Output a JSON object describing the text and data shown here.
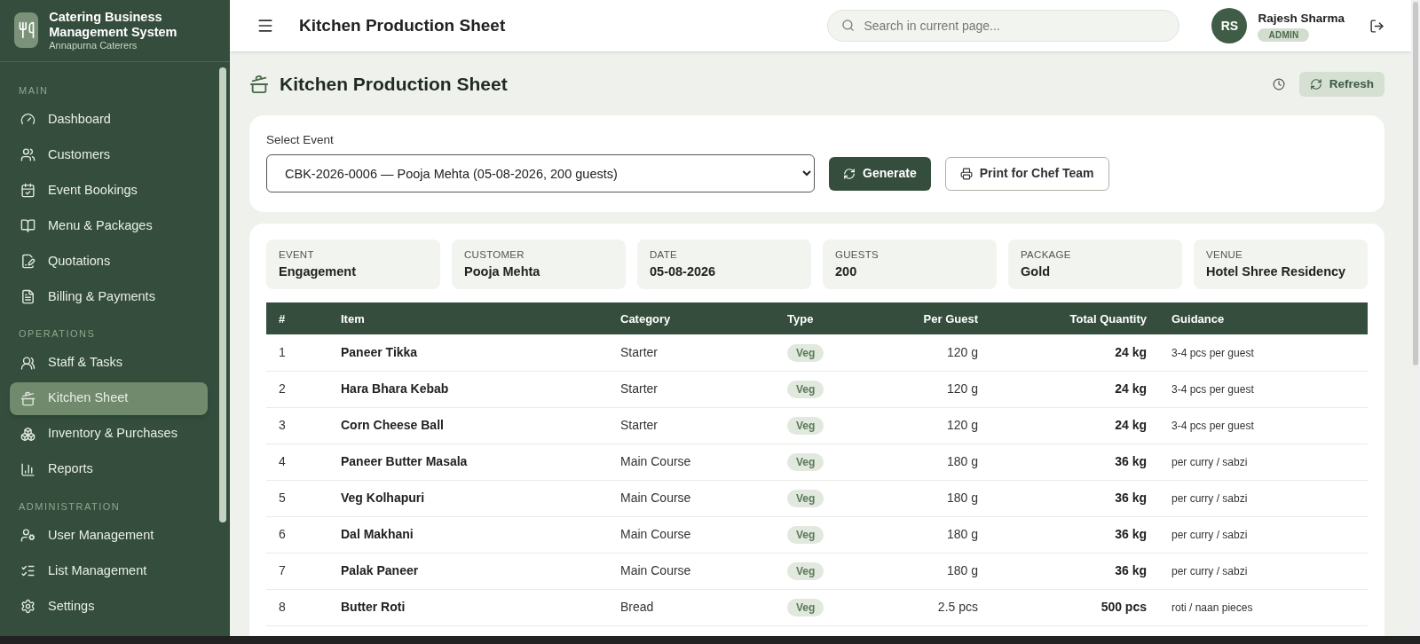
{
  "sidebar": {
    "brand": {
      "title": "Catering Business Management System",
      "subtitle": "Annapurna Caterers"
    },
    "sections": [
      {
        "heading": "MAIN",
        "items": [
          {
            "label": "Dashboard",
            "selected": false
          },
          {
            "label": "Customers",
            "selected": false
          },
          {
            "label": "Event Bookings",
            "selected": false
          },
          {
            "label": "Menu & Packages",
            "selected": false
          },
          {
            "label": "Quotations",
            "selected": false
          },
          {
            "label": "Billing & Payments",
            "selected": false
          }
        ]
      },
      {
        "heading": "OPERATIONS",
        "items": [
          {
            "label": "Staff & Tasks",
            "selected": false
          },
          {
            "label": "Kitchen Sheet",
            "selected": true
          },
          {
            "label": "Inventory & Purchases",
            "selected": false
          },
          {
            "label": "Reports",
            "selected": false
          }
        ]
      },
      {
        "heading": "ADMINISTRATION",
        "items": [
          {
            "label": "User Management",
            "selected": false
          },
          {
            "label": "List Management",
            "selected": false
          },
          {
            "label": "Settings",
            "selected": false
          }
        ]
      }
    ]
  },
  "header": {
    "title": "Kitchen Production Sheet",
    "search": {
      "placeholder": "Search in current page..."
    },
    "user": {
      "initials": "RS",
      "name": "Rajesh Sharma",
      "role": "ADMIN"
    }
  },
  "page": {
    "title": "Kitchen Production Sheet",
    "refresh": "Refresh"
  },
  "event_select": {
    "label": "Select Event",
    "value": "CBK-2026-0006 — Pooja Mehta (05-08-2026, 200 guests)",
    "generate": "Generate",
    "print": "Print for Chef Team"
  },
  "summary": [
    {
      "label": "EVENT",
      "value": "Engagement"
    },
    {
      "label": "CUSTOMER",
      "value": "Pooja Mehta"
    },
    {
      "label": "DATE",
      "value": "05-08-2026"
    },
    {
      "label": "GUESTS",
      "value": "200"
    },
    {
      "label": "PACKAGE",
      "value": "Gold"
    },
    {
      "label": "VENUE",
      "value": "Hotel Shree Residency"
    }
  ],
  "table": {
    "columns": [
      "#",
      "Item",
      "Category",
      "Type",
      "Per Guest",
      "Total Quantity",
      "Guidance"
    ],
    "rows": [
      {
        "no": "1",
        "item": "Paneer Tikka",
        "category": "Starter",
        "type": "Veg",
        "per_guest": "120 g",
        "total": "24 kg",
        "guidance": "3-4 pcs per guest"
      },
      {
        "no": "2",
        "item": "Hara Bhara Kebab",
        "category": "Starter",
        "type": "Veg",
        "per_guest": "120 g",
        "total": "24 kg",
        "guidance": "3-4 pcs per guest"
      },
      {
        "no": "3",
        "item": "Corn Cheese Ball",
        "category": "Starter",
        "type": "Veg",
        "per_guest": "120 g",
        "total": "24 kg",
        "guidance": "3-4 pcs per guest"
      },
      {
        "no": "4",
        "item": "Paneer Butter Masala",
        "category": "Main Course",
        "type": "Veg",
        "per_guest": "180 g",
        "total": "36 kg",
        "guidance": "per curry / sabzi"
      },
      {
        "no": "5",
        "item": "Veg Kolhapuri",
        "category": "Main Course",
        "type": "Veg",
        "per_guest": "180 g",
        "total": "36 kg",
        "guidance": "per curry / sabzi"
      },
      {
        "no": "6",
        "item": "Dal Makhani",
        "category": "Main Course",
        "type": "Veg",
        "per_guest": "180 g",
        "total": "36 kg",
        "guidance": "per curry / sabzi"
      },
      {
        "no": "7",
        "item": "Palak Paneer",
        "category": "Main Course",
        "type": "Veg",
        "per_guest": "180 g",
        "total": "36 kg",
        "guidance": "per curry / sabzi"
      },
      {
        "no": "8",
        "item": "Butter Roti",
        "category": "Bread",
        "type": "Veg",
        "per_guest": "2.5 pcs",
        "total": "500 pcs",
        "guidance": "roti / naan pieces"
      }
    ]
  }
}
